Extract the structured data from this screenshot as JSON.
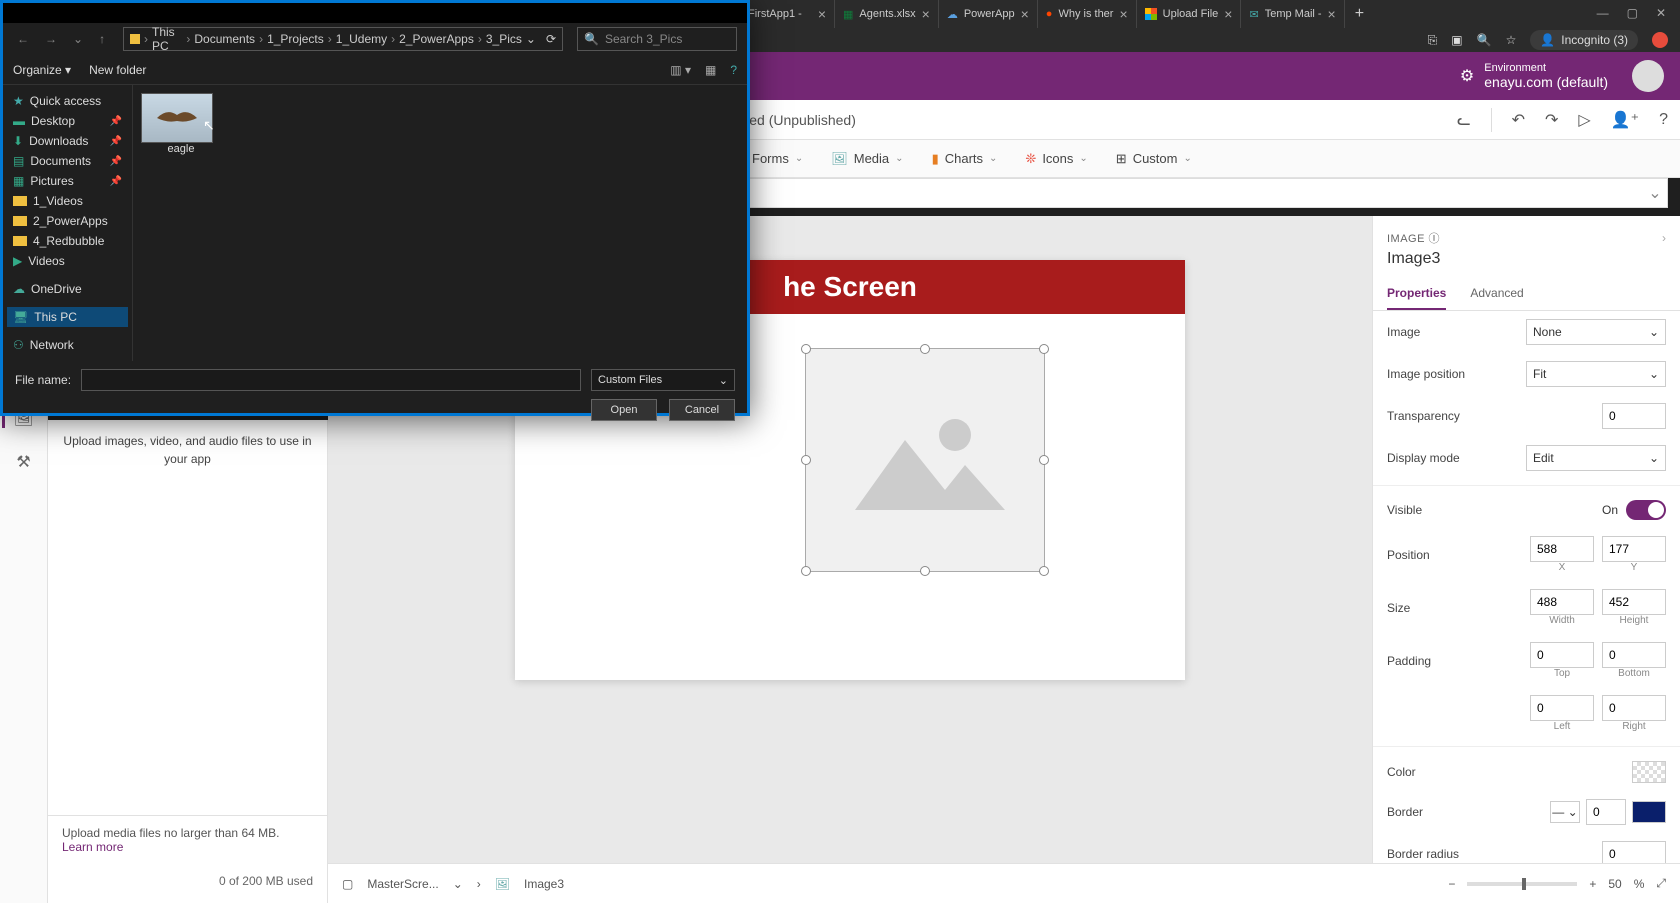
{
  "browser": {
    "tabs": [
      {
        "label": "FirstApp1 -"
      },
      {
        "label": "Agents.xlsx"
      },
      {
        "label": "PowerApp"
      },
      {
        "label": "Why is ther"
      },
      {
        "label": "Upload File"
      },
      {
        "label": "Temp Mail -"
      }
    ],
    "incognito": "Incognito (3)"
  },
  "header": {
    "env_label": "Environment",
    "env_name": "enayu.com (default)"
  },
  "title": "FirstCanvasApp - Saved (Unpublished)",
  "ribbon": {
    "forms": "Forms",
    "media": "Media",
    "charts": "Charts",
    "icons": "Icons",
    "custom": "Custom"
  },
  "media_panel": {
    "upload": "Upload images, video, and audio files to use in your app",
    "footer_text": "Upload media files no larger than 64 MB.",
    "learn_more": "Learn more",
    "usage": "0 of 200 MB used"
  },
  "canvas": {
    "header_text": "he Screen"
  },
  "props": {
    "category": "IMAGE",
    "name": "Image3",
    "tab_props": "Properties",
    "tab_adv": "Advanced",
    "image_label": "Image",
    "image_val": "None",
    "imgpos_label": "Image position",
    "imgpos_val": "Fit",
    "transp_label": "Transparency",
    "transp_val": "0",
    "disp_label": "Display mode",
    "disp_val": "Edit",
    "visible_label": "Visible",
    "visible_on": "On",
    "pos_label": "Position",
    "pos_x": "588",
    "pos_y": "177",
    "pos_xlab": "X",
    "pos_ylab": "Y",
    "size_label": "Size",
    "size_w": "488",
    "size_h": "452",
    "size_wlab": "Width",
    "size_hlab": "Height",
    "pad_label": "Padding",
    "pad_t": "0",
    "pad_b": "0",
    "pad_l": "0",
    "pad_r": "0",
    "pad_tlab": "Top",
    "pad_blab": "Bottom",
    "pad_llab": "Left",
    "pad_rlab": "Right",
    "color_label": "Color",
    "border_label": "Border",
    "border_val": "0",
    "bradius_label": "Border radius",
    "bradius_val": "0"
  },
  "bottombar": {
    "screen": "MasterScre...",
    "img": "Image3",
    "zoom": "50",
    "pct": "%"
  },
  "dialog": {
    "path": [
      "This PC",
      "Documents",
      "1_Projects",
      "1_Udemy",
      "2_PowerApps",
      "3_Pics"
    ],
    "search_placeholder": "Search 3_Pics",
    "organize": "Organize",
    "newfolder": "New folder",
    "tree": {
      "quick": "Quick access",
      "desktop": "Desktop",
      "downloads": "Downloads",
      "documents": "Documents",
      "pictures": "Pictures",
      "videos1": "1_Videos",
      "powerapps": "2_PowerApps",
      "redbubble": "4_Redbubble",
      "videos": "Videos",
      "onedrive": "OneDrive",
      "thispc": "This PC",
      "network": "Network"
    },
    "file_eagle": "eagle",
    "filename_label": "File name:",
    "filter": "Custom Files",
    "open": "Open",
    "cancel": "Cancel"
  }
}
